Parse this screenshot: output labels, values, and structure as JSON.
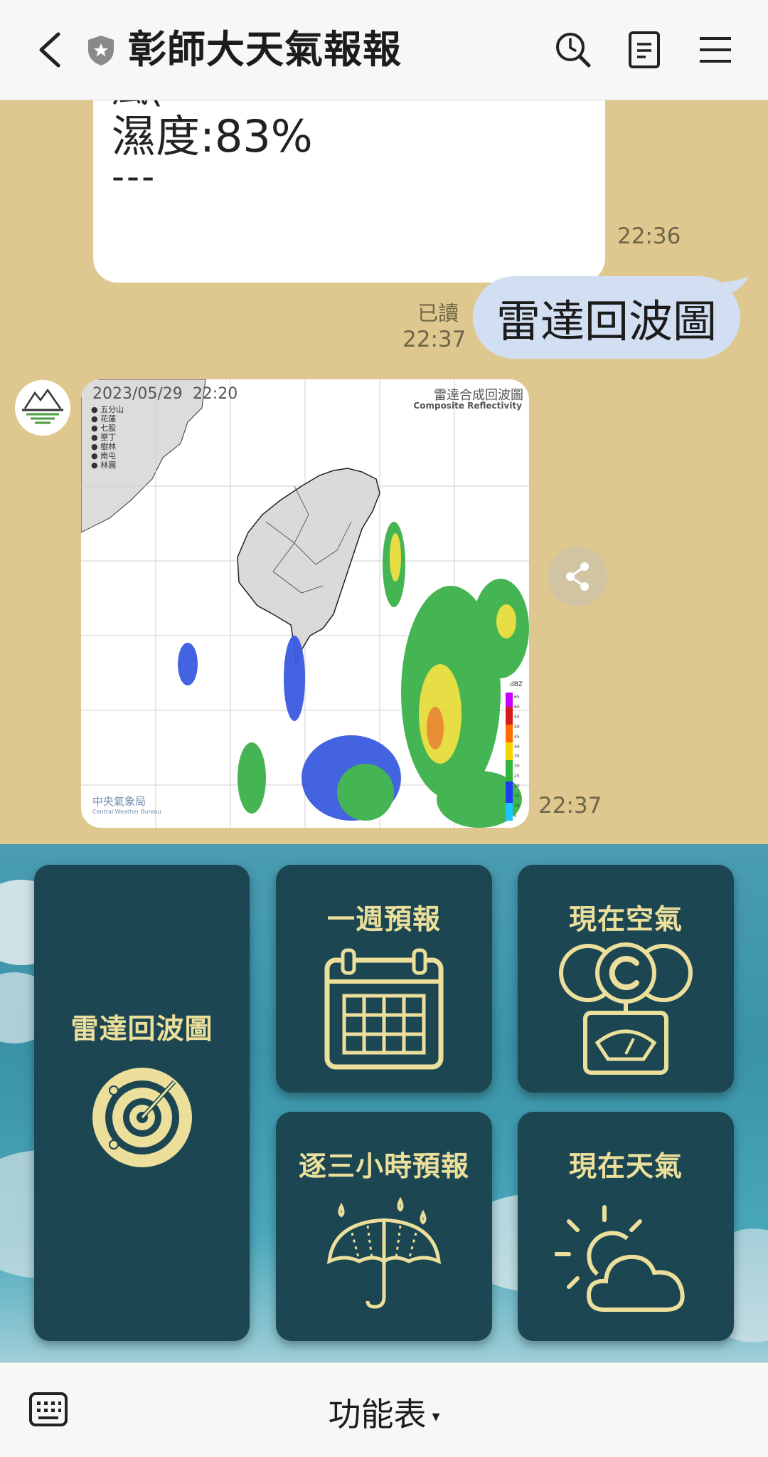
{
  "header": {
    "title": "彰師大天氣報報",
    "back_icon": "chevron-left-icon",
    "verified_icon": "shield-star-icon",
    "search_icon": "search-history-icon",
    "notes_icon": "notes-icon",
    "menu_icon": "hamburger-menu-icon"
  },
  "chat": {
    "prev_message": {
      "partial_line": "風(",
      "humidity": "濕度:83%",
      "separator": "---",
      "time": "22:36"
    },
    "user_message": {
      "text": "雷達回波圖",
      "read_status": "已讀",
      "time": "22:37"
    },
    "image_message": {
      "date": "2023/05/29",
      "clock": "22:20",
      "title_zh": "雷達合成回波圖",
      "title_en": "Composite Reflectivity",
      "stations": [
        "五分山",
        "花蓮",
        "七股",
        "墾丁",
        "樹林",
        "南屯",
        "林園"
      ],
      "agency_zh": "中央氣象局",
      "agency_en": "Central Weather Bureau",
      "legend_unit": "dBZ",
      "legend_values": [
        "65",
        "60",
        "55",
        "50",
        "45",
        "40",
        "35",
        "30",
        "25",
        "20",
        "15",
        "10",
        "5"
      ],
      "time": "22:37",
      "share_icon": "share-icon"
    }
  },
  "rich_menu": {
    "tiles": [
      {
        "label": "雷達回波圖",
        "icon": "radar-icon"
      },
      {
        "label": "一週預報",
        "icon": "calendar-icon"
      },
      {
        "label": "現在空氣",
        "icon": "air-quality-gauge-icon"
      },
      {
        "label": "逐三小時預報",
        "icon": "umbrella-rain-icon"
      },
      {
        "label": "現在天氣",
        "icon": "sun-cloud-icon"
      }
    ],
    "accent_color": "#ecdf9b",
    "tile_color": "#1b4652"
  },
  "bottom_bar": {
    "keyboard_icon": "keyboard-icon",
    "label": "功能表",
    "caret": "▾"
  }
}
